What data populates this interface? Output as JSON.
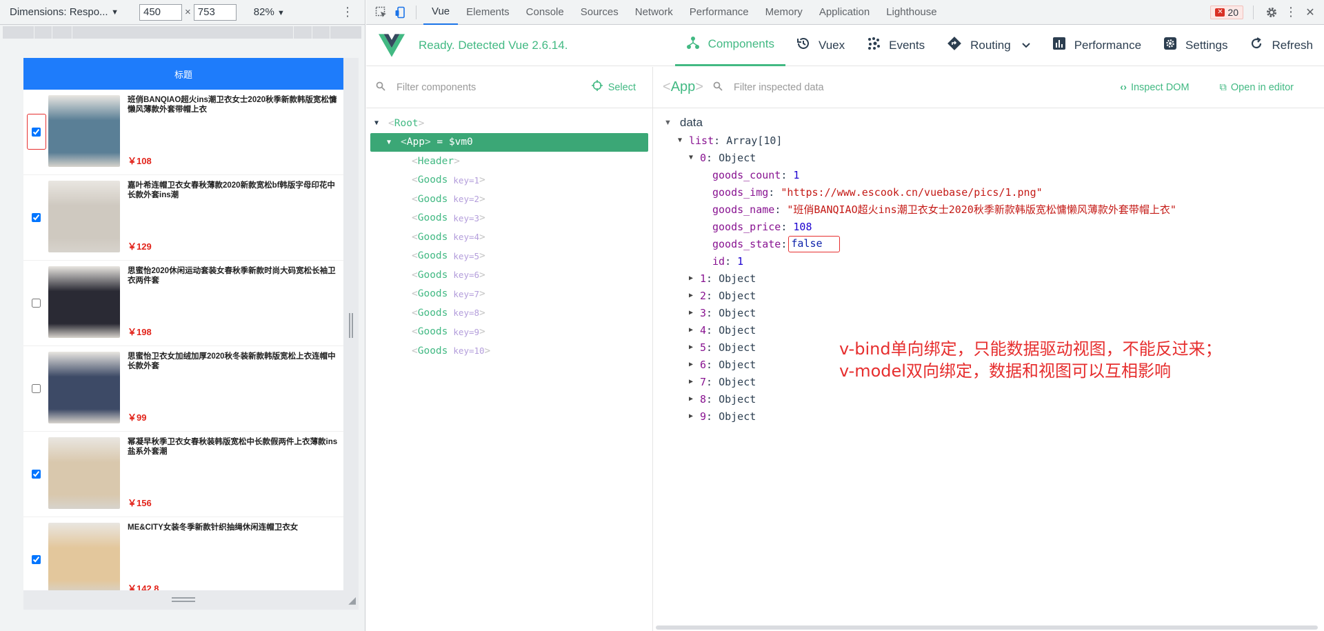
{
  "device_toolbar": {
    "dimensions_label": "Dimensions: Respo...",
    "width_value": "450",
    "height_value": "753",
    "times_sign": "×",
    "zoom": "82%",
    "dropdown_caret": "▼",
    "menu_glyph": "⋮"
  },
  "app": {
    "header_title": "标题",
    "goods": [
      {
        "name": "班俏BANQIAO超火ins潮卫衣女士2020秋季新款韩版宽松慵懒风薄款外套带帽上衣",
        "price": "￥108",
        "checked": true,
        "img_color": "#5a7f96",
        "highlight": true
      },
      {
        "name": "嘉叶希连帽卫衣女春秋薄款2020新款宽松bf韩版字母印花中长款外套ins潮",
        "price": "￥129",
        "checked": true,
        "img_color": "#cfc9c0",
        "highlight": false
      },
      {
        "name": "思蜜怡2020休闲运动套装女春秋季新款时尚大码宽松长袖卫衣两件套",
        "price": "￥198",
        "checked": false,
        "img_color": "#2a2a34",
        "highlight": false
      },
      {
        "name": "思蜜怡卫衣女加绒加厚2020秋冬装新款韩版宽松上衣连帽中长款外套",
        "price": "￥99",
        "checked": false,
        "img_color": "#3d4a66",
        "highlight": false
      },
      {
        "name": "幂凝早秋季卫衣女春秋装韩版宽松中长款假两件上衣薄款ins盐系外套潮",
        "price": "￥156",
        "checked": true,
        "img_color": "#d9c8ad",
        "highlight": false
      },
      {
        "name": "ME&CITY女装冬季新款针织抽绳休闲连帽卫衣女",
        "price": "￥142.8",
        "checked": true,
        "img_color": "#e3c79c",
        "highlight": false
      }
    ]
  },
  "devtools": {
    "tabs": [
      "Vue",
      "Elements",
      "Console",
      "Sources",
      "Network",
      "Performance",
      "Memory",
      "Application",
      "Lighthouse"
    ],
    "active_tab": "Vue",
    "error_count": "20"
  },
  "vue": {
    "status": "Ready. Detected Vue 2.6.14.",
    "nav": {
      "components": "Components",
      "vuex": "Vuex",
      "events": "Events",
      "routing": "Routing",
      "performance": "Performance",
      "settings": "Settings",
      "refresh": "Refresh"
    },
    "filter_components_placeholder": "Filter components",
    "select_label": "Select",
    "tree": {
      "root": "Root",
      "app": "App",
      "app_suffix": " = $vm0",
      "header": "Header",
      "goods_tag": "Goods",
      "goods_keys": [
        "key=1",
        "key=2",
        "key=3",
        "key=4",
        "key=5",
        "key=6",
        "key=7",
        "key=8",
        "key=9",
        "key=10"
      ]
    },
    "inspector": {
      "tag": "App",
      "filter_placeholder": "Filter inspected data",
      "inspect_dom": "Inspect DOM",
      "open_in_editor": "Open in editor",
      "section": "data",
      "list_key": "list",
      "list_value": "Array[10]",
      "item0_key": "0",
      "object_label": "Object",
      "fields": {
        "goods_count_key": "goods_count",
        "goods_count_val": "1",
        "goods_img_key": "goods_img",
        "goods_img_val": "\"https://www.escook.cn/vuebase/pics/1.png\"",
        "goods_name_key": "goods_name",
        "goods_name_val": "\"班俏BANQIAO超火ins潮卫衣女士2020秋季新款韩版宽松慵懒风薄款外套带帽上衣\"",
        "goods_price_key": "goods_price",
        "goods_price_val": "108",
        "goods_state_key": "goods_state",
        "goods_state_val": "false",
        "id_key": "id",
        "id_val": "1"
      },
      "collapsed_items": [
        "1",
        "2",
        "3",
        "4",
        "5",
        "6",
        "7",
        "8",
        "9"
      ]
    },
    "annotation": {
      "line1": "v-bind单向绑定，只能数据驱动视图，不能反过来；",
      "line2": "v-model双向绑定，数据和视图可以互相影响"
    }
  },
  "colors": {
    "vue_green": "#42b983",
    "header_blue": "#1e7cfb",
    "price_red": "#e2231a",
    "annotation_red": "#e62e2e"
  }
}
